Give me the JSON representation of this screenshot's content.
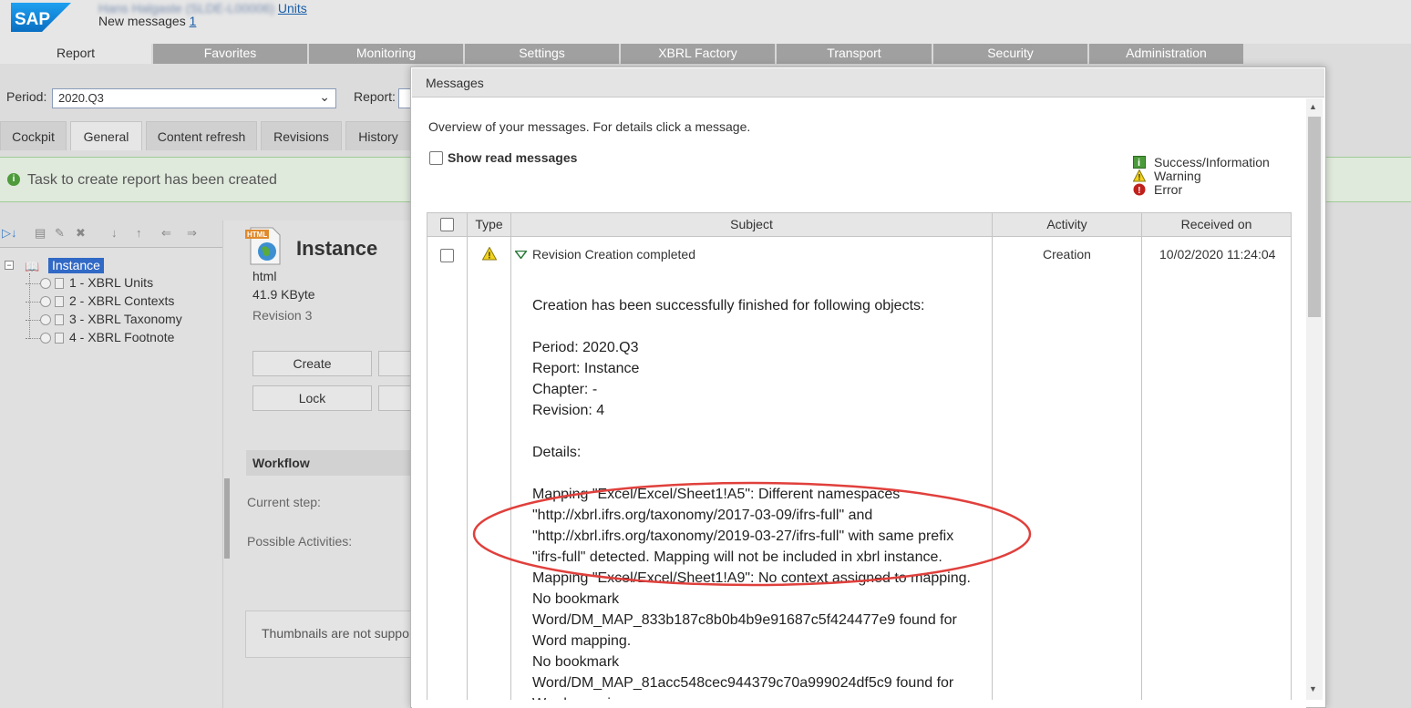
{
  "header": {
    "logo_text": "SAP",
    "user_blurred": "Hans Halgaste (SLDE-L00006)",
    "units_link": "Units",
    "new_messages_label": "New messages",
    "new_messages_count": "1"
  },
  "nav": {
    "tabs": [
      "Report",
      "Favorites",
      "Monitoring",
      "Settings",
      "XBRL Factory",
      "Transport",
      "Security",
      "Administration"
    ],
    "active": "Report"
  },
  "filters": {
    "period_label": "Period:",
    "period_value": "2020.Q3",
    "report_label": "Report:"
  },
  "subtabs": {
    "items": [
      "Cockpit",
      "General",
      "Content refresh",
      "Revisions",
      "History"
    ],
    "active": "General"
  },
  "status_message": "Task to create report has been created",
  "tree": {
    "root": "Instance",
    "items": [
      "1 - XBRL Units",
      "2 - XBRL Contexts",
      "3 - XBRL Taxonomy",
      "4 - XBRL Footnote"
    ]
  },
  "detail": {
    "icon_label": "HTML",
    "title": "Instance",
    "format": "html",
    "size": "41.9 KByte",
    "revision": "Revision 3",
    "create_button": "Create",
    "lock_button": "Lock",
    "workflow_header": "Workflow",
    "current_step_label": "Current step:",
    "possible_activities_label": "Possible Activities:",
    "thumbnails_text": "Thumbnails are not supported"
  },
  "dialog": {
    "title": "Messages",
    "intro": "Overview of your messages. For details click a message.",
    "show_read_label": "Show read messages",
    "show_read_checked": false,
    "legend": [
      {
        "label": "Success/Information",
        "icon": "info-icon",
        "color": "#4a9a3a"
      },
      {
        "label": "Warning",
        "icon": "warning-icon",
        "color": "#f2d21b"
      },
      {
        "label": "Error",
        "icon": "error-icon",
        "color": "#c0201c"
      }
    ],
    "table": {
      "columns": [
        "",
        "Type",
        "Subject",
        "Activity",
        "Received on"
      ],
      "rows": [
        {
          "type_icon": "warning-icon",
          "subject": "Revision Creation completed",
          "activity": "Creation",
          "received_on": "10/02/2020 11:24:04"
        }
      ]
    },
    "message_detail": {
      "line1": "Creation has been successfully finished for following objects:",
      "period": "Period: 2020.Q3",
      "report": "Report: Instance",
      "chapter": "Chapter: -",
      "revision": "Revision: 4",
      "details_label": "Details:",
      "mapping1_l1": "Mapping \"Excel/Excel/Sheet1!A5\": Different namespaces",
      "mapping1_l2": "\"http://xbrl.ifrs.org/taxonomy/2017-03-09/ifrs-full\" and",
      "mapping1_l3": "\"http://xbrl.ifrs.org/taxonomy/2019-03-27/ifrs-full\" with same prefix",
      "mapping1_l4": "\"ifrs-full\" detected. Mapping will not be included in xbrl instance.",
      "mapping2": "Mapping \"Excel/Excel/Sheet1!A9\": No context assigned to mapping.",
      "bookmark1_l1": "No bookmark",
      "bookmark1_l2": "Word/DM_MAP_833b187c8b0b4b9e91687c5f424477e9 found for",
      "bookmark1_l3": "Word mapping.",
      "bookmark2_l1": "No bookmark",
      "bookmark2_l2": "Word/DM_MAP_81acc548cec944379c70a999024df5c9 found for",
      "bookmark2_l3": "Word mapping."
    },
    "highlight_color": "#e0403c"
  }
}
